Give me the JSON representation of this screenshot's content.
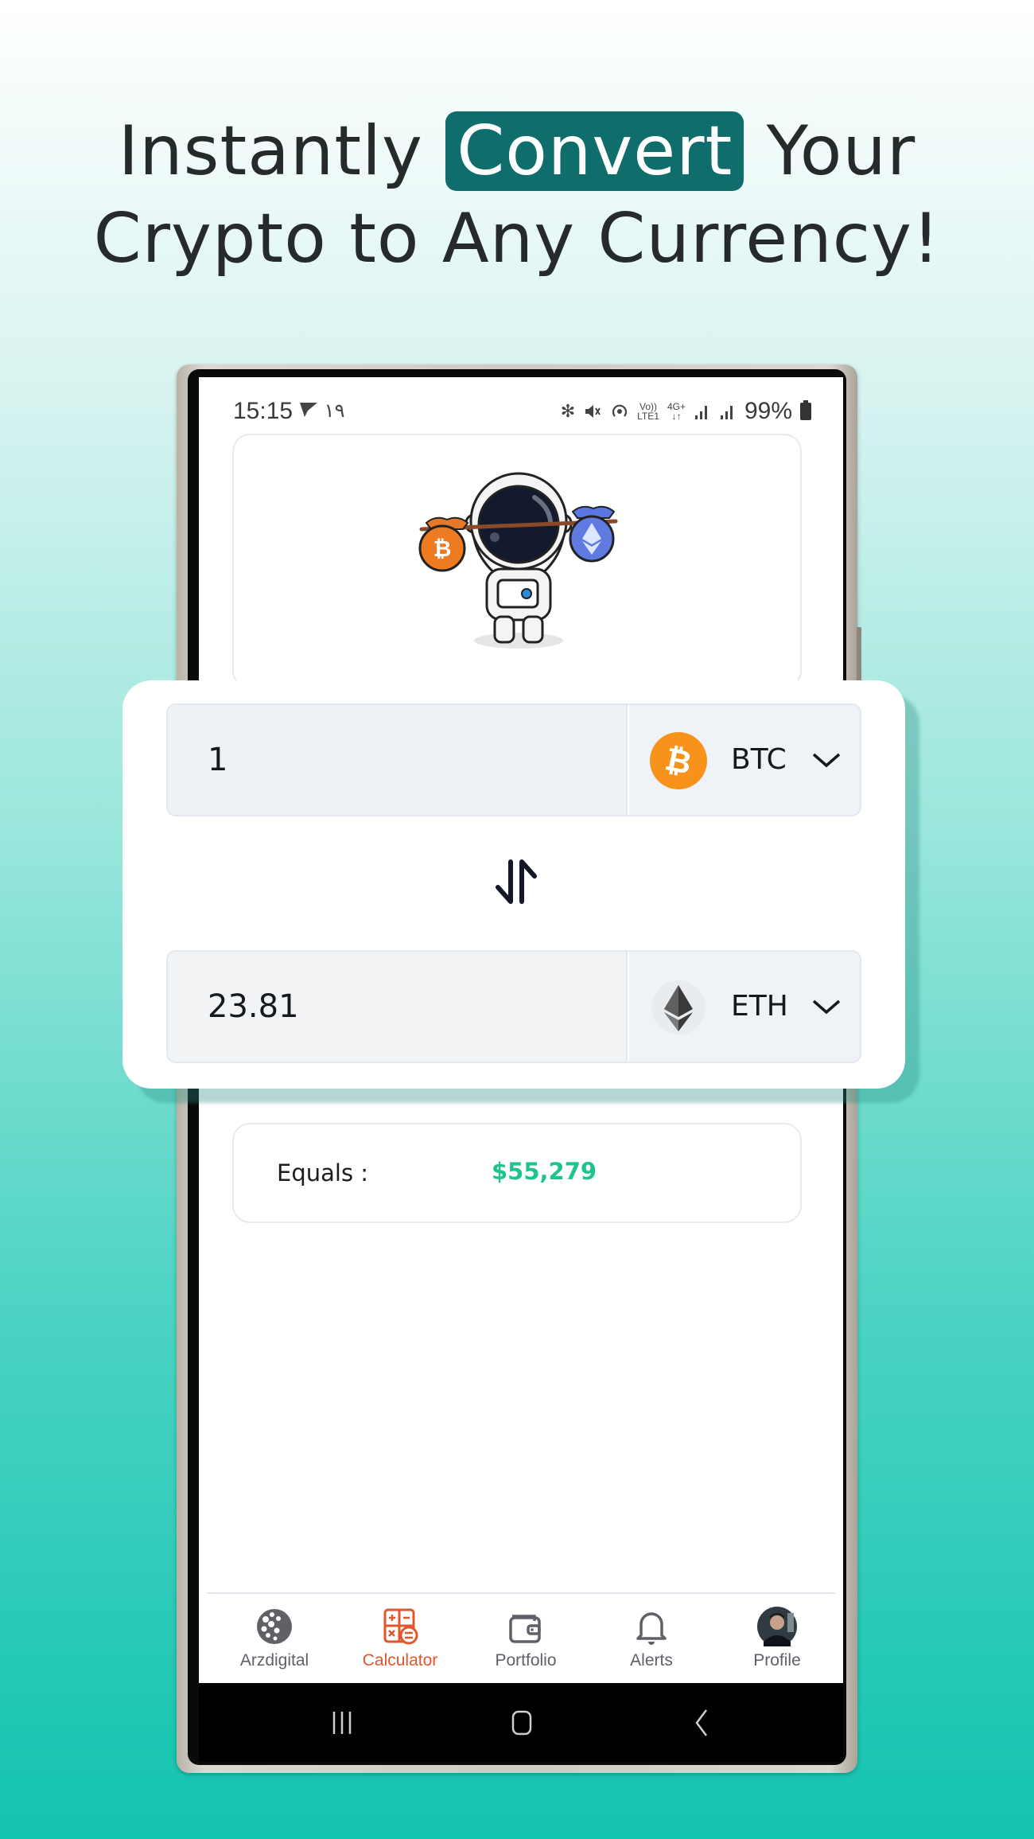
{
  "headline": {
    "before": "Instantly ",
    "highlight": "Convert",
    "after": " Your",
    "line2": "Crypto to Any Currency!"
  },
  "colors": {
    "highlight_bg": "#0f6e6c",
    "accent_active_tab": "#e2562b",
    "equals_value": "#1fc48a",
    "btc": "#f7931a"
  },
  "status_bar": {
    "time": "15:15",
    "extra": "۱۹",
    "network_top": "Vo))",
    "network_bottom": "LTE1",
    "gen": "4G+",
    "battery": "99%"
  },
  "converter": {
    "from": {
      "amount": "1",
      "symbol": "BTC",
      "icon": "bitcoin-icon"
    },
    "to": {
      "amount": "23.81",
      "symbol": "ETH",
      "icon": "ethereum-icon"
    },
    "swap_icon": "swap-vertical-icon"
  },
  "result": {
    "label": "Equals :",
    "value": "$55,279"
  },
  "tabs": [
    {
      "label": "Arzdigital",
      "icon": "arzdigital-logo-icon",
      "active": false
    },
    {
      "label": "Calculator",
      "icon": "calculator-icon",
      "active": true
    },
    {
      "label": "Portfolio",
      "icon": "wallet-icon",
      "active": false
    },
    {
      "label": "Alerts",
      "icon": "bell-icon",
      "active": false
    },
    {
      "label": "Profile",
      "icon": "avatar",
      "active": false
    }
  ],
  "system_nav": [
    "recents-icon",
    "home-icon",
    "back-icon"
  ]
}
